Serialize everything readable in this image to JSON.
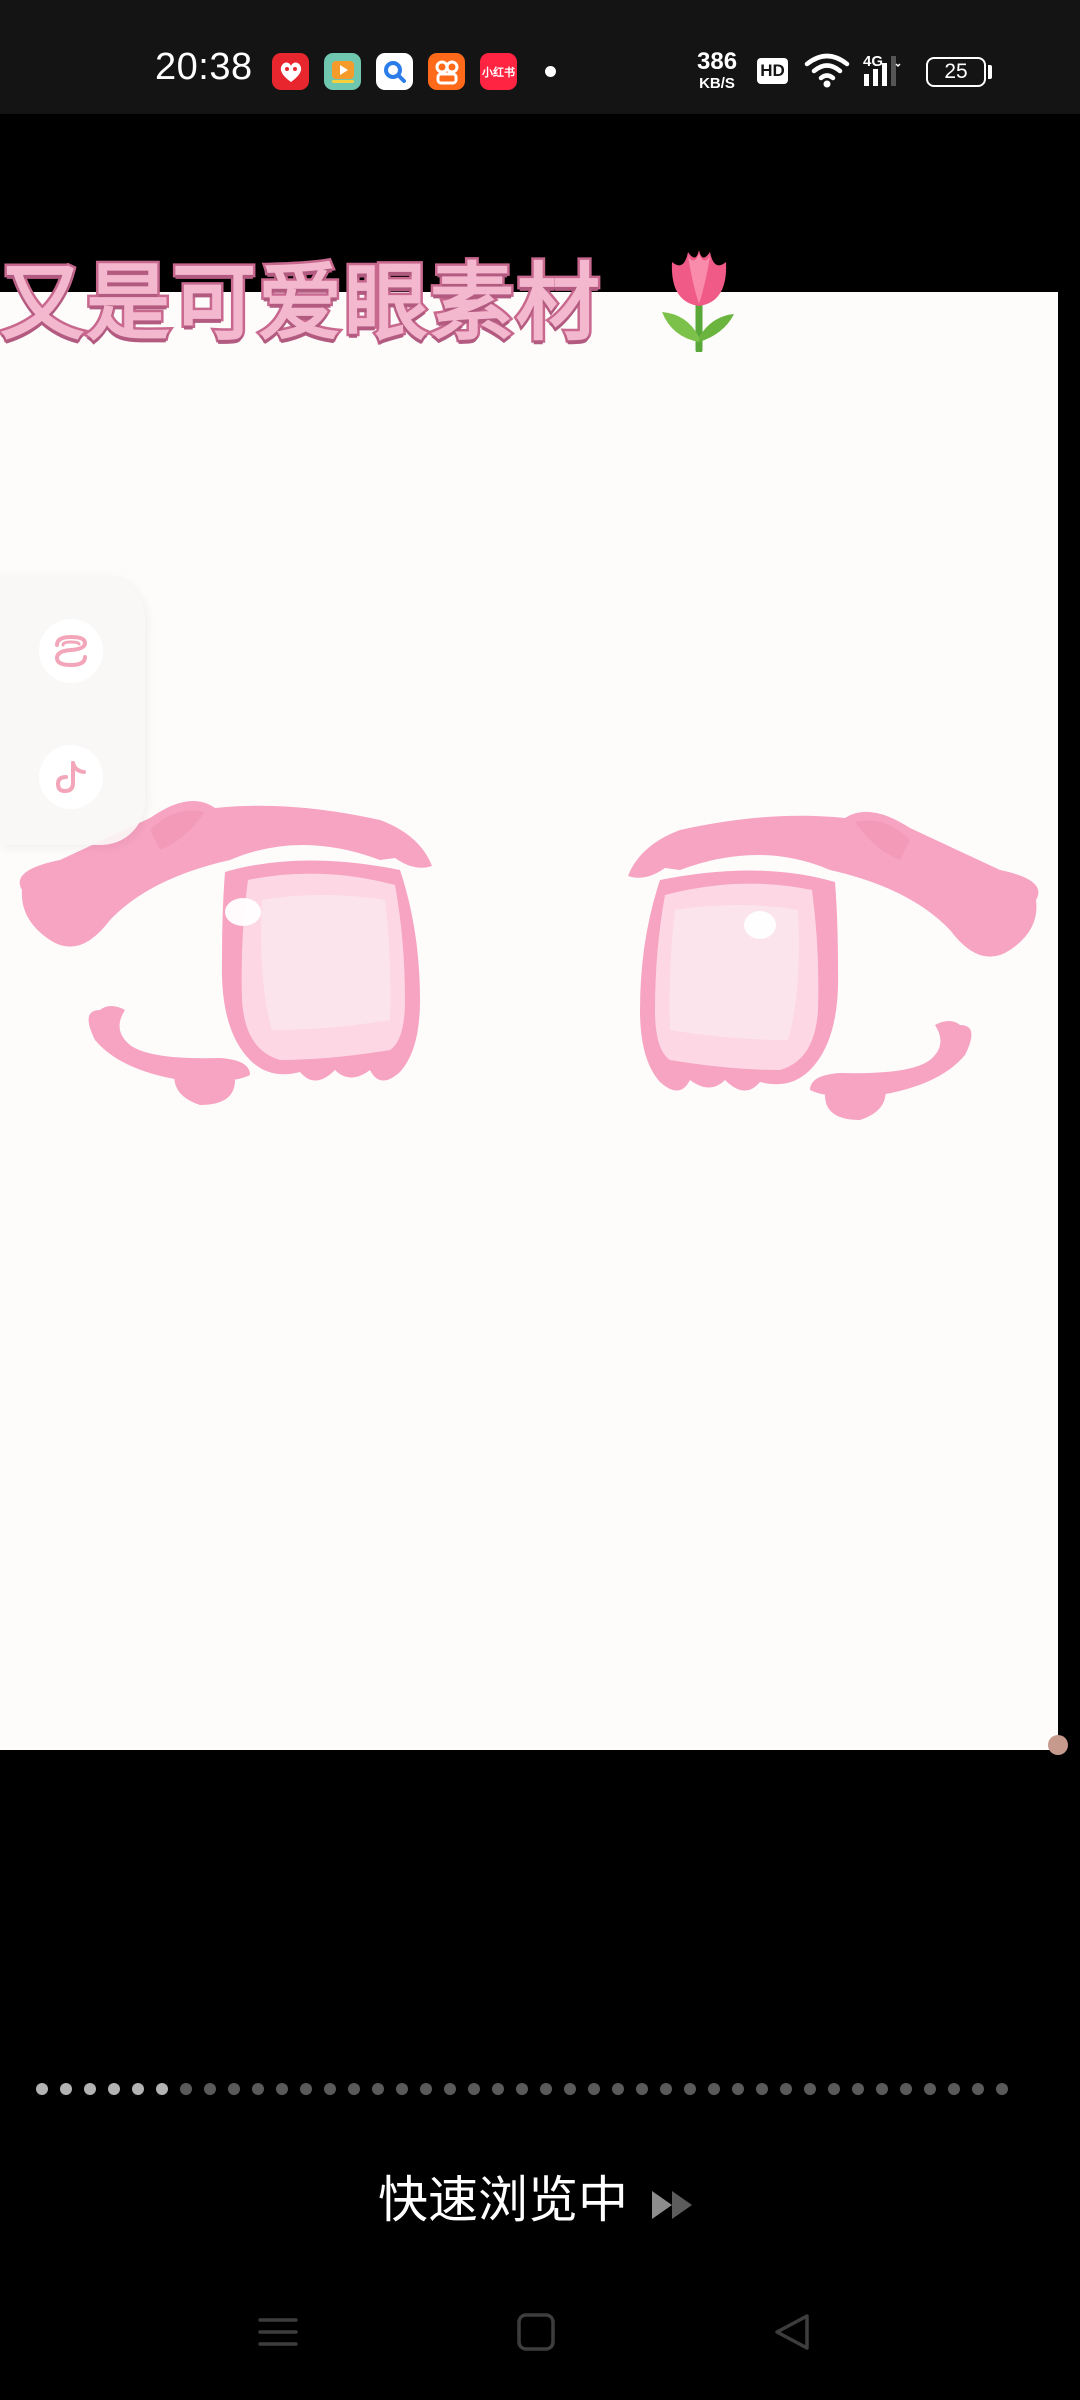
{
  "status_bar": {
    "time": "20:38",
    "app_icons": [
      {
        "name": "heart-app-icon",
        "bg": "#e8262e",
        "glyph": "❤"
      },
      {
        "name": "video-app-icon",
        "bg": "#f59b2b",
        "glyph": "▶"
      },
      {
        "name": "search-app-icon",
        "bg": "#ffffff",
        "glyph": "🔍"
      },
      {
        "name": "kuaishou-app-icon",
        "bg": "#ff6a1a",
        "glyph": "✿"
      },
      {
        "name": "xiaohongshu-app-icon",
        "bg": "#ff2442",
        "glyph": "小红书"
      }
    ],
    "net_speed_value": "386",
    "net_speed_unit": "KB/S",
    "hd_label": "HD",
    "network_type": "4G",
    "battery_level": "25"
  },
  "post": {
    "overlay_title": "又是可爱眼素材",
    "title_emoji": "tulip"
  },
  "share_panel": {
    "buttons": [
      "weibo-share",
      "douyin-share"
    ]
  },
  "pager": {
    "total": 41,
    "active_index": 5
  },
  "footer": {
    "status_text": "快速浏览中"
  },
  "colors": {
    "eye_pink": "#f7a3c2",
    "eye_light": "#fdd8e4",
    "title_fill": "#f3b8cd",
    "title_stroke": "#c8688e"
  }
}
